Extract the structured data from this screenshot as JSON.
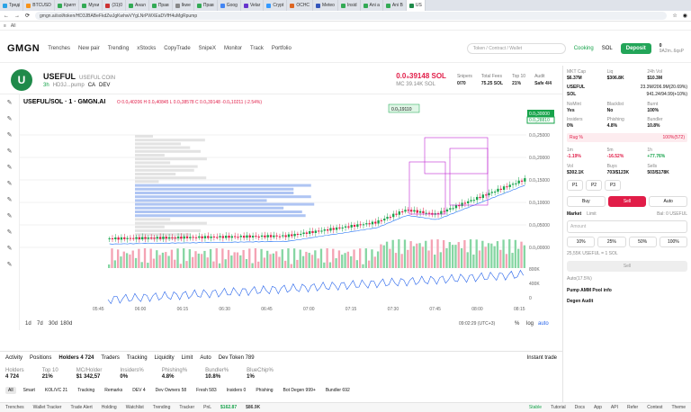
{
  "browser": {
    "tabs": [
      {
        "label": "Треді",
        "color": "#2aa3e5"
      },
      {
        "label": "BTCUSD",
        "color": "#f7931a"
      },
      {
        "label": "Крипт",
        "color": "#33aa55"
      },
      {
        "label": "Мухи",
        "color": "#33aa55"
      },
      {
        "label": "(31)0",
        "color": "#cc3333"
      },
      {
        "label": "Анал",
        "color": "#33aa55"
      },
      {
        "label": "Прав",
        "color": "#33aa55"
      },
      {
        "label": "Ikwe",
        "color": "#888888"
      },
      {
        "label": "Прав",
        "color": "#33aa55"
      },
      {
        "label": "Goog",
        "color": "#4285f4"
      },
      {
        "label": "Velar",
        "color": "#6633cc"
      },
      {
        "label": "Crypt",
        "color": "#3399ff"
      },
      {
        "label": "OCHC",
        "color": "#dd6622"
      },
      {
        "label": "Meteo",
        "color": "#3355bb"
      },
      {
        "label": "Insid",
        "color": "#33aa55"
      },
      {
        "label": "Ani a",
        "color": "#33aa55"
      },
      {
        "label": "Ani B",
        "color": "#33aa55"
      },
      {
        "label": "US",
        "color": "#1f8a4a"
      }
    ],
    "url": "gmgn.ai/sol/token/HD3JBABeFkdZwJgKwhwVYgLNrPWXEaDVfH4uMgRpump",
    "bookmark": "All"
  },
  "nav": {
    "logo": "GMGN",
    "links": [
      "Trenches",
      "New pair",
      "Trending",
      "xStocks",
      "CopyTrade",
      "SnipeX",
      "Monitor",
      "Track",
      "Portfolio"
    ],
    "search": "Token / Contract / Wallet",
    "cooking": "Cooking",
    "chain": "SOL",
    "deposit": "Deposit",
    "balance": "0",
    "wallet": "9A2m..6qsP"
  },
  "token": {
    "symbol": "USEFUL",
    "name": "USEFUL COIN",
    "age": "3h",
    "short_addr": "HD3J...pump",
    "price": "0.0₅39148 SOL",
    "mc": "MC 39.14K SOL",
    "stats": [
      {
        "label": "Snipers",
        "value": "0/70"
      },
      {
        "label": "Total Fees",
        "value": "75.25 SOL"
      },
      {
        "label": "Top 10",
        "value": "21%"
      },
      {
        "label": "Audit",
        "value": "Safe 4/4"
      }
    ],
    "actions": [
      "CA",
      "DEV"
    ]
  },
  "chart": {
    "title": "USEFUL/SOL · 1 · GMGN.AI",
    "ohlc": "O 0.0₅40206 H 0.0₅40845 L 0.0₅38578 C 0.0₅39148 -0.0₆10211 (-2.54%)",
    "price_tag": "0.0₅19110",
    "last_price": "0.0₅30000",
    "mark_price": "0.0₅28810",
    "axis_labels": [
      "0.0₅25000",
      "0.0₅20000",
      "0.0₅15000",
      "0.0₅10000",
      "0.0₅05000",
      "0.0₅00000"
    ],
    "vol_labels": [
      "800K",
      "400K",
      "0"
    ],
    "times": [
      "05:45",
      "06:00",
      "06:15",
      "06:30",
      "06:45",
      "07:00",
      "07:15",
      "07:30",
      "07:45",
      "08:00",
      "08:15"
    ],
    "ranges": [
      "1d",
      "7d",
      "30d",
      "180d"
    ],
    "clock": "09:02:29 (UTC+3)",
    "scale": [
      "%",
      "log",
      "auto"
    ]
  },
  "right": {
    "top_stats": [
      {
        "k": "MKT Cap",
        "v": "$6.37M"
      },
      {
        "k": "Liq",
        "v": "$306.8K"
      },
      {
        "k": "24h Vol",
        "v": "$10.3M"
      }
    ],
    "pair": [
      {
        "k": "USEFUL",
        "v": "23.3M/206.9M(20.69%)"
      },
      {
        "k": "SOL",
        "v": "941.24/94.99(+10%)"
      }
    ],
    "safety": [
      {
        "k": "NoMint",
        "v": "Yes"
      },
      {
        "k": "Blacklist",
        "v": "No"
      },
      {
        "k": "Burnt",
        "v": "100%"
      }
    ],
    "insiders": [
      {
        "k": "Insiders",
        "v": "0%"
      },
      {
        "k": "Phishing",
        "v": "4.8%"
      },
      {
        "k": "Bundler",
        "v": "10.8%"
      }
    ],
    "rug": "Rug %",
    "rug_val": "100%(572)",
    "periods": [
      {
        "k": "1m",
        "v": "-1.19%"
      },
      {
        "k": "5m",
        "v": "-16.52%"
      },
      {
        "k": "1h",
        "v": "+77.76%"
      }
    ],
    "flow": [
      {
        "k": "Vol",
        "v": "$302.1K"
      },
      {
        "k": "Buys",
        "v": "703/$123K"
      },
      {
        "k": "Sells",
        "v": "503/$178K"
      }
    ],
    "presets": [
      "P1",
      "P2",
      "P3"
    ],
    "buy": "Buy",
    "sell": "Sell",
    "auto": "Auto",
    "modes": [
      "Market",
      "Limit"
    ],
    "bal": "Bal: 0 USEFUL",
    "amount_placeholder": "Amount",
    "pcts": [
      "10%",
      "25%",
      "50%",
      "100%"
    ],
    "rate": "25,55K USEFUL = 1 SOL",
    "submit": "Sell",
    "fee": "Auto(17.5%)",
    "pool": "Pump AMM Pool info",
    "degen": "Degen Audit"
  },
  "bottom": {
    "tabs": [
      "Activity",
      "Positions",
      "Holders 4 724",
      "Traders",
      "Tracking",
      "Liquidity",
      "Limit",
      "Auto",
      "Dev Token 789"
    ],
    "instant": "Instant trade",
    "metrics": [
      {
        "k": "Holders",
        "v": "4 724"
      },
      {
        "k": "Top 10",
        "v": "21%"
      },
      {
        "k": "MC/Holder",
        "v": "$1 342,57"
      },
      {
        "k": "Insiders%",
        "v": "0%"
      },
      {
        "k": "Phishing%",
        "v": "4.8%"
      },
      {
        "k": "Bundler%",
        "v": "10.8%"
      },
      {
        "k": "BlueChip%",
        "v": "1%"
      }
    ],
    "filters": [
      "All",
      "Smart",
      "KOL/VC 21",
      "Tracking",
      "Remarks",
      "DEV 4",
      "Dev Owners 58",
      "Fresh 583",
      "Insiders 0",
      "Phishing",
      "Bot Degen 999+",
      "Bundler 692"
    ]
  },
  "status": {
    "items": [
      "Trenches",
      "Wallet Tracker",
      "Trade Alert",
      "Holding",
      "Watchlist",
      "Trending",
      "Tracker",
      "PnL"
    ],
    "sol_price": "$162.87",
    "bnb": "$86.9K",
    "stable": "Stable",
    "right": [
      "Tutorial",
      "Docs",
      "App",
      "API",
      "Refer",
      "Contest",
      "Theme"
    ]
  }
}
